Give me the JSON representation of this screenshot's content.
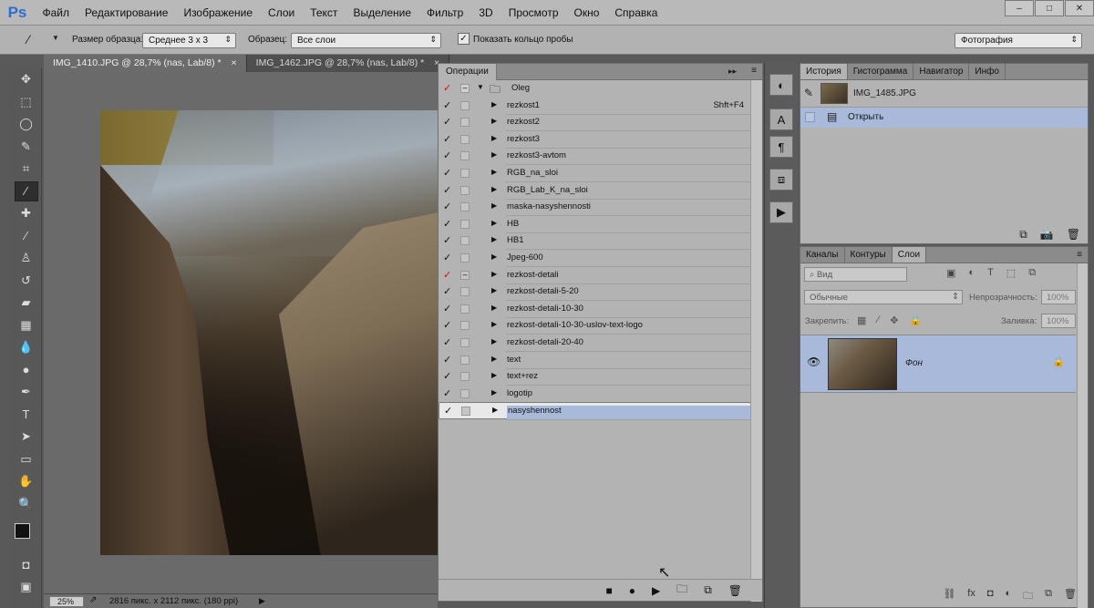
{
  "app": {
    "logo": "Ps"
  },
  "menu": [
    "Файл",
    "Редактирование",
    "Изображение",
    "Слои",
    "Текст",
    "Выделение",
    "Фильтр",
    "3D",
    "Просмотр",
    "Окно",
    "Справка"
  ],
  "window_controls": {
    "minimize": "–",
    "maximize": "□",
    "close": "✕"
  },
  "options": {
    "sample_size_label": "Размер образца:",
    "sample_size_value": "Среднее 3 x 3",
    "sample_label": "Образец:",
    "sample_value": "Все слои",
    "show_ring_label": "Показать кольцо пробы",
    "workspace_value": "Фотография"
  },
  "doc_tabs": [
    {
      "label": "IMG_1410.JPG @ 28,7% (nas, Lab/8) *",
      "close": "×"
    },
    {
      "label": "IMG_1462.JPG @ 28,7% (nas, Lab/8) *",
      "close": "×"
    }
  ],
  "status": {
    "zoom": "25%",
    "info": "2816 пикс. x 2112 пикс. (180 ppi)"
  },
  "actions_panel": {
    "tab": "Операции",
    "set_name": "Oleg",
    "items": [
      {
        "name": "rezkost1",
        "key": "Shft+F4",
        "check_color": "#111111"
      },
      {
        "name": "rezkost2",
        "key": "",
        "check_color": "#111111"
      },
      {
        "name": "rezkost3",
        "key": "",
        "check_color": "#111111"
      },
      {
        "name": "rezkost3-avtom",
        "key": "",
        "check_color": "#111111"
      },
      {
        "name": "RGB_na_sloi",
        "key": "",
        "check_color": "#111111"
      },
      {
        "name": "RGB_Lab_K_na_sloi",
        "key": "",
        "check_color": "#111111"
      },
      {
        "name": "maska-nasyshennosti",
        "key": "",
        "check_color": "#111111"
      },
      {
        "name": "HB",
        "key": "",
        "check_color": "#111111"
      },
      {
        "name": "HB1",
        "key": "",
        "check_color": "#111111"
      },
      {
        "name": "Jpeg-600",
        "key": "",
        "check_color": "#111111"
      },
      {
        "name": "rezkost-detali",
        "key": "",
        "check_color": "#cc1111"
      },
      {
        "name": "rezkost-detali-5-20",
        "key": "",
        "check_color": "#111111"
      },
      {
        "name": "rezkost-detali-10-30",
        "key": "",
        "check_color": "#111111"
      },
      {
        "name": "rezkost-detali-10-30-uslov-text-logo",
        "key": "",
        "check_color": "#111111"
      },
      {
        "name": "rezkost-detali-20-40",
        "key": "",
        "check_color": "#111111"
      },
      {
        "name": "text",
        "key": "",
        "check_color": "#111111"
      },
      {
        "name": "text+rez",
        "key": "",
        "check_color": "#111111"
      },
      {
        "name": "logotip",
        "key": "",
        "check_color": "#111111"
      },
      {
        "name": "nasyshennost",
        "key": "",
        "check_color": "#111111",
        "selected": true
      }
    ],
    "footer_icons": [
      "stop-icon",
      "record-icon",
      "play-icon",
      "new-set-icon",
      "new-action-icon",
      "delete-icon"
    ]
  },
  "history_panel": {
    "tabs": [
      "История",
      "Гистограмма",
      "Навигатор",
      "Инфо"
    ],
    "snapshot": "IMG_1485.JPG",
    "states": [
      "Открыть"
    ]
  },
  "layers_panel": {
    "tabs": [
      "Каналы",
      "Контуры",
      "Слои"
    ],
    "filter_placeholder": "Вид",
    "blend_mode": "Обычные",
    "opacity_label": "Непрозрачность:",
    "opacity_value": "100%",
    "lock_label": "Закрепить:",
    "fill_label": "Заливка:",
    "fill_value": "100%",
    "layer_name": "Фон"
  },
  "colors": {
    "accent_selection": "#a9b9d9",
    "panel_bg": "#b3b3b3",
    "red_check": "#cc1111"
  }
}
